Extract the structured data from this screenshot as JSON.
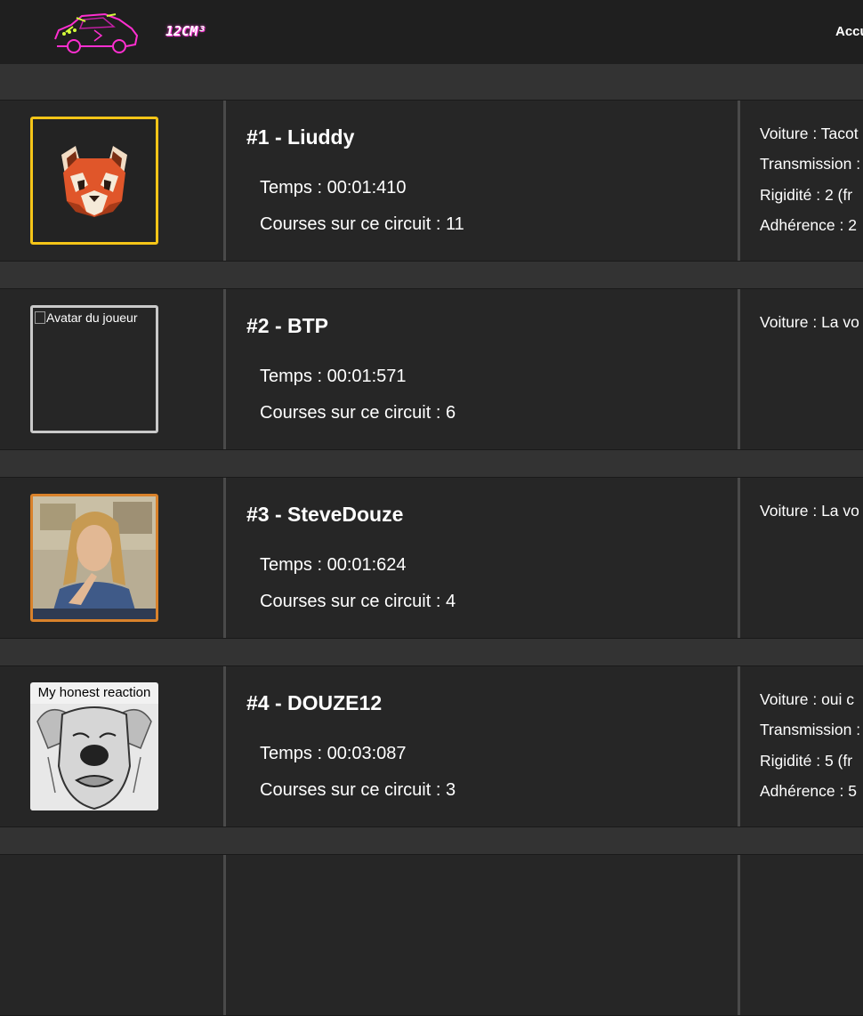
{
  "navbar": {
    "brand": "12CM³",
    "link": "Accu",
    "logo_icon": "neon-car-logo"
  },
  "leaderboard": [
    {
      "title": "#1 - Liuddy",
      "time": "Temps : 00:01:410",
      "races": "Courses sur ce circuit : 11",
      "avatar": {
        "type": "red-panda-icon",
        "border": "#f5c518"
      },
      "car": [
        "Voiture : Tacot",
        "Transmission :",
        "Rigidité : 2 (fr",
        "Adhérence : 2"
      ]
    },
    {
      "title": "#2 - BTP",
      "time": "Temps : 00:01:571",
      "races": "Courses sur ce circuit : 6",
      "avatar": {
        "type": "broken-image",
        "alt": "Avatar du joueur",
        "border": "#c9c9c9"
      },
      "car": [
        "Voiture : La vo"
      ]
    },
    {
      "title": "#3 - SteveDouze",
      "time": "Temps : 00:01:624",
      "races": "Courses sur ce circuit : 4",
      "avatar": {
        "type": "person-photo",
        "border": "#d9822b"
      },
      "car": [
        "Voiture : La vo"
      ]
    },
    {
      "title": "#4 - DOUZE12",
      "time": "Temps : 00:03:087",
      "races": "Courses sur ce circuit : 3",
      "avatar": {
        "type": "meme-sketch",
        "caption": "My honest reaction",
        "border": "none"
      },
      "car": [
        "Voiture : oui c",
        "Transmission :",
        "Rigidité : 5 (fr",
        "Adhérence : 5"
      ]
    }
  ],
  "colors": {
    "page_bg": "#333333",
    "navbar_bg": "#1f1f1f",
    "row_bg": "#262626",
    "divider": "#4a4a4a",
    "gold": "#f5c518",
    "silver": "#c9c9c9",
    "bronze": "#d9822b",
    "brand_glow": "#ff3ad8"
  }
}
